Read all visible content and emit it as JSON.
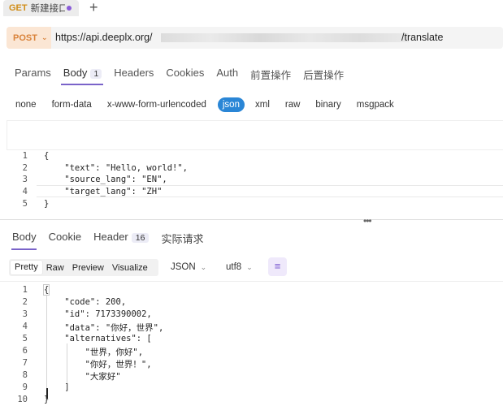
{
  "tab": {
    "method": "GET",
    "name": "新建接口"
  },
  "url_bar": {
    "method": "POST",
    "url_start": "https://api.deeplx.org/",
    "url_end": "/translate"
  },
  "request_tabs": [
    {
      "label": "Params"
    },
    {
      "label": "Body",
      "badge": "1"
    },
    {
      "label": "Headers"
    },
    {
      "label": "Cookies"
    },
    {
      "label": "Auth"
    },
    {
      "label": "前置操作"
    },
    {
      "label": "后置操作"
    }
  ],
  "body_types": [
    "none",
    "form-data",
    "x-www-form-urlencoded",
    "json",
    "xml",
    "raw",
    "binary",
    "msgpack"
  ],
  "body_type_selected": "json",
  "request_body": {
    "line_numbers": [
      "1",
      "2",
      "3",
      "4",
      "5"
    ],
    "lines": [
      "{",
      "    \"text\": \"Hello, world!\",",
      "    \"source_lang\": \"EN\",",
      "    \"target_lang\": \"ZH\"",
      "}"
    ]
  },
  "response_tabs": [
    {
      "label": "Body"
    },
    {
      "label": "Cookie"
    },
    {
      "label": "Header",
      "badge": "16"
    },
    {
      "label": "实际请求"
    }
  ],
  "response_view_modes": [
    "Pretty",
    "Raw",
    "Preview",
    "Visualize"
  ],
  "response_format": "JSON",
  "response_encoding": "utf8",
  "response_body": {
    "line_numbers": [
      "1",
      "2",
      "3",
      "4",
      "5",
      "6",
      "7",
      "8",
      "9",
      "10"
    ],
    "lines": [
      "{",
      "    \"code\": 200,",
      "    \"id\": 7173390002,",
      "    \"data\": \"你好，世界\",",
      "    \"alternatives\": [",
      "        \"世界，你好\",",
      "        \"你好，世界！\",",
      "        \"大家好\"",
      "    ]",
      "}"
    ]
  },
  "colors": {
    "accent": "#7a63c9",
    "post_method": "#d9823a",
    "get_method": "#d08c16",
    "json_selected": "#2a86d6"
  }
}
